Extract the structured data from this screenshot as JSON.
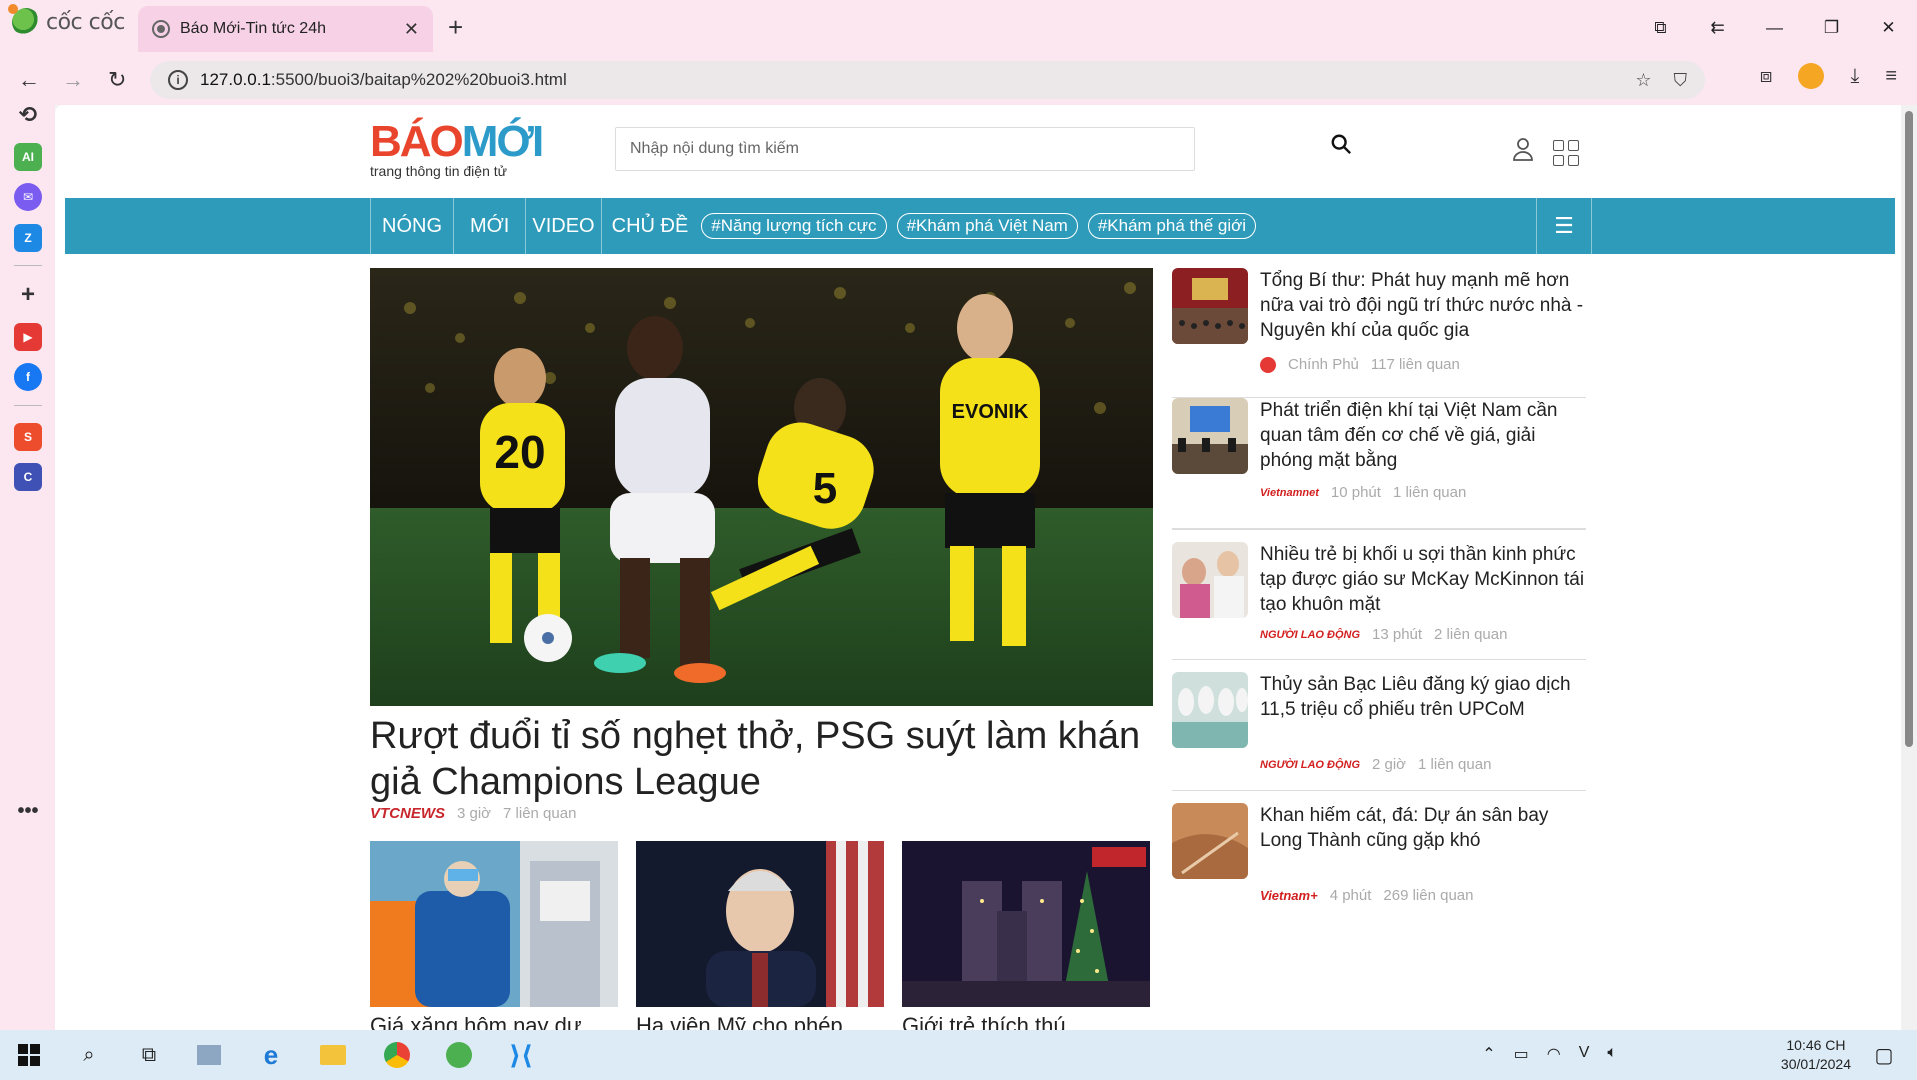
{
  "browser": {
    "brand": "cốc cốc",
    "tab_title": "Báo Mới-Tin tức 24h",
    "url_host": "127.0.0.1",
    "url_rest": ":5500/buoi3/baitap%202%20buoi3.html"
  },
  "site": {
    "logo_main_a": "BÁO",
    "logo_main_b": "MỚI",
    "logo_sub": "trang thông tin điện tử",
    "search_placeholder": "Nhập nội dung tìm kiếm"
  },
  "nav": {
    "items": [
      "NÓNG",
      "MỚI",
      "VIDEO"
    ],
    "topics_label": "CHỦ ĐỀ",
    "tags": [
      "#Năng lượng tích cực",
      "#Khám phá Việt Nam",
      "#Khám phá thế giới"
    ]
  },
  "hero": {
    "title": "Rượt đuổi tỉ số nghẹt thở, PSG suýt làm khán giả Champions League",
    "source": "VTCNEWS",
    "time": "3 giờ",
    "related": "7 liên quan"
  },
  "thumbs": [
    {
      "title": "Giá xăng hôm nay dự"
    },
    {
      "title": "Hạ viện Mỹ cho phép"
    },
    {
      "title": "Giới trẻ thích thú"
    }
  ],
  "news": [
    {
      "title": "Tổng Bí thư: Phát huy mạnh mẽ hơn nữa vai trò đội ngũ trí thức nước nhà - Nguyên khí của quốc gia",
      "source": "Chính Phủ",
      "time": "",
      "related": "117 liên quan"
    },
    {
      "title": "Phát triển điện khí tại Việt Nam cần quan tâm đến cơ chế về giá, giải phóng mặt bằng",
      "source": "Vietnamnet",
      "time": "10 phút",
      "related": "1 liên quan"
    },
    {
      "title": "Nhiều trẻ bị khối u sợi thần kinh phức tạp được giáo sư McKay McKinnon tái tạo khuôn mặt",
      "source": "NGƯỜI LAO ĐỘNG",
      "time": "13 phút",
      "related": "2 liên quan"
    },
    {
      "title": "Thủy sản Bạc Liêu đăng ký giao dịch 11,5 triệu cổ phiếu trên UPCoM",
      "source": "NGƯỜI LAO ĐỘNG",
      "time": "2 giờ",
      "related": "1 liên quan"
    },
    {
      "title": "Khan hiếm cát, đá: Dự án sân bay Long Thành cũng gặp khó",
      "source": "Vietnam+",
      "time": "4 phút",
      "related": "269 liên quan"
    }
  ],
  "taskbar": {
    "time": "10:46 CH",
    "date": "30/01/2024"
  },
  "colors": {
    "nav_bg": "#2d9bb9",
    "logo_red": "#e8452c",
    "logo_blue": "#2d9bc9",
    "chrome_bg": "#fce7f1"
  }
}
